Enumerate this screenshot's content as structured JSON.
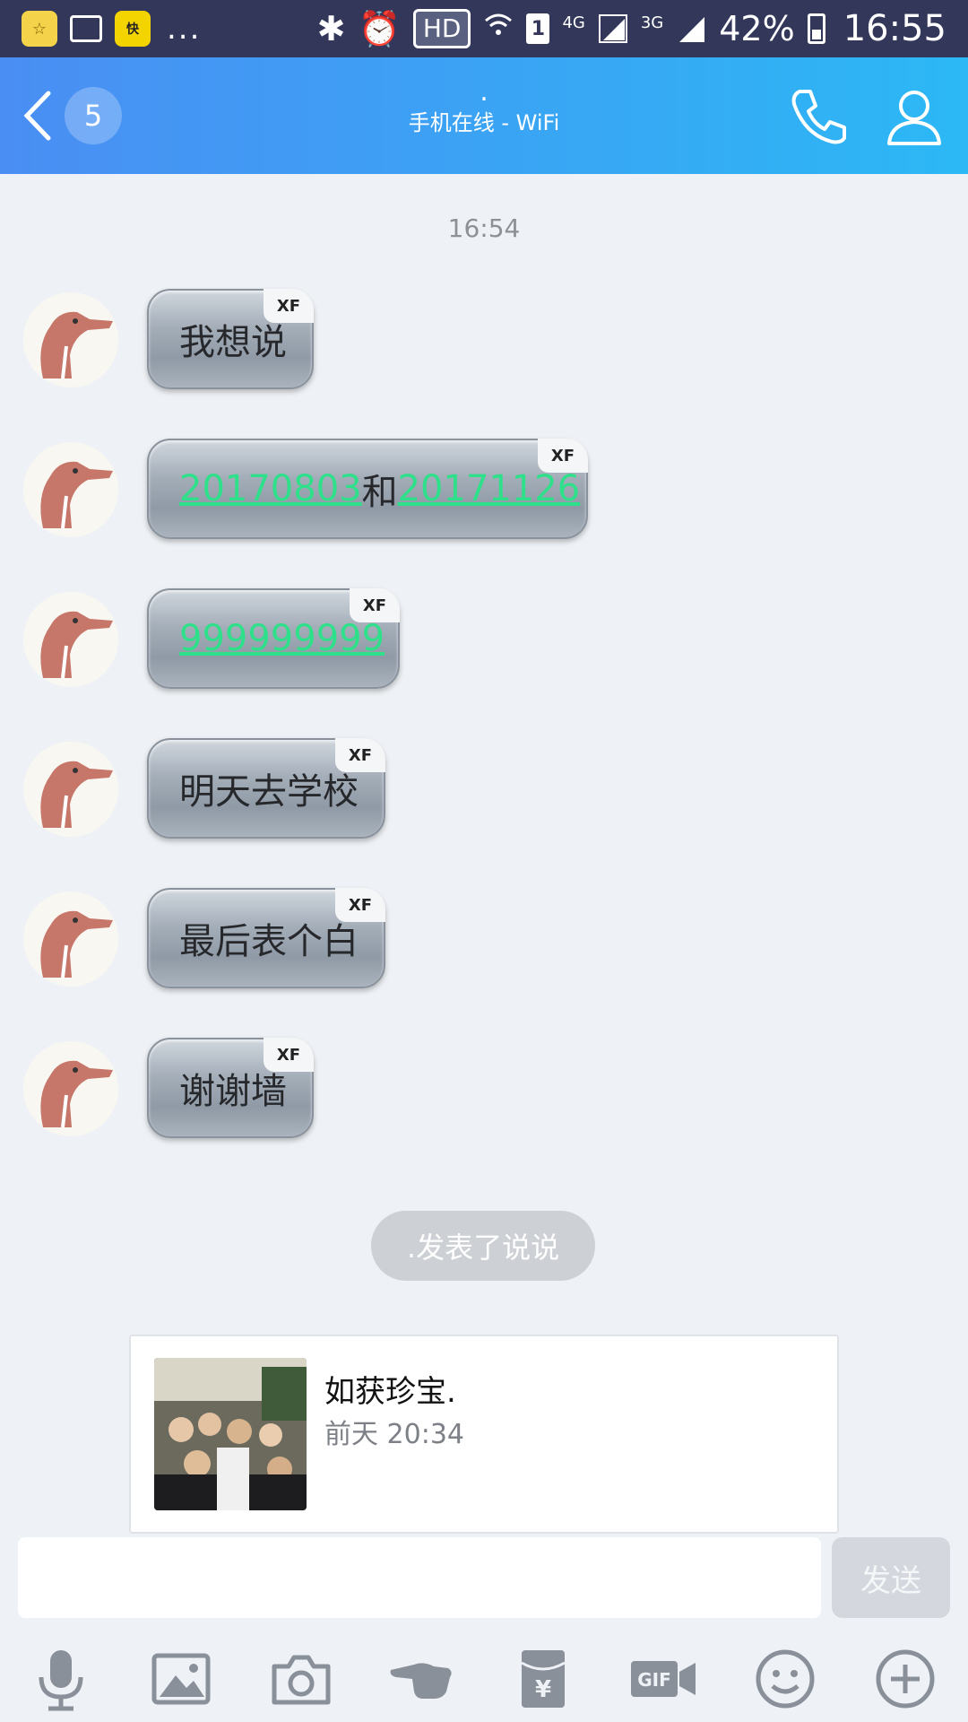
{
  "status_bar": {
    "dots": "...",
    "hd": "HD",
    "sim_slot": "1",
    "net_4g": "4G",
    "net_3g": "3G",
    "battery": "42%",
    "time": "16:55"
  },
  "header": {
    "unread_count": "5",
    "contact_name": ".",
    "contact_status": "手机在线 - WiFi"
  },
  "chat": {
    "timestamp": "16:54",
    "messages": [
      {
        "tag": "XF",
        "text": "我想说"
      },
      {
        "tag": "XF",
        "part1": "20170803",
        "part2": "和",
        "part3": "20171126"
      },
      {
        "tag": "XF",
        "text": "999999999"
      },
      {
        "tag": "XF",
        "text": "明天去学校"
      },
      {
        "tag": "XF",
        "text": "最后表个白"
      },
      {
        "tag": "XF",
        "text": "谢谢墙"
      }
    ],
    "post_notice": ".发表了说说",
    "post_card": {
      "title": "如获珍宝.",
      "time": "前天 20:34"
    }
  },
  "input": {
    "value": "",
    "send_label": "发送"
  },
  "toolbar": {
    "icons": [
      "microphone-icon",
      "image-icon",
      "camera-icon",
      "poke-hand-icon",
      "red-envelope-icon",
      "gif-icon",
      "emoji-icon",
      "plus-icon"
    ],
    "gif_label": "GIF"
  },
  "colors": {
    "header_start": "#4a8ef3",
    "header_end": "#2cb8f5",
    "link": "#2fe08a",
    "background": "#eef1f5"
  }
}
